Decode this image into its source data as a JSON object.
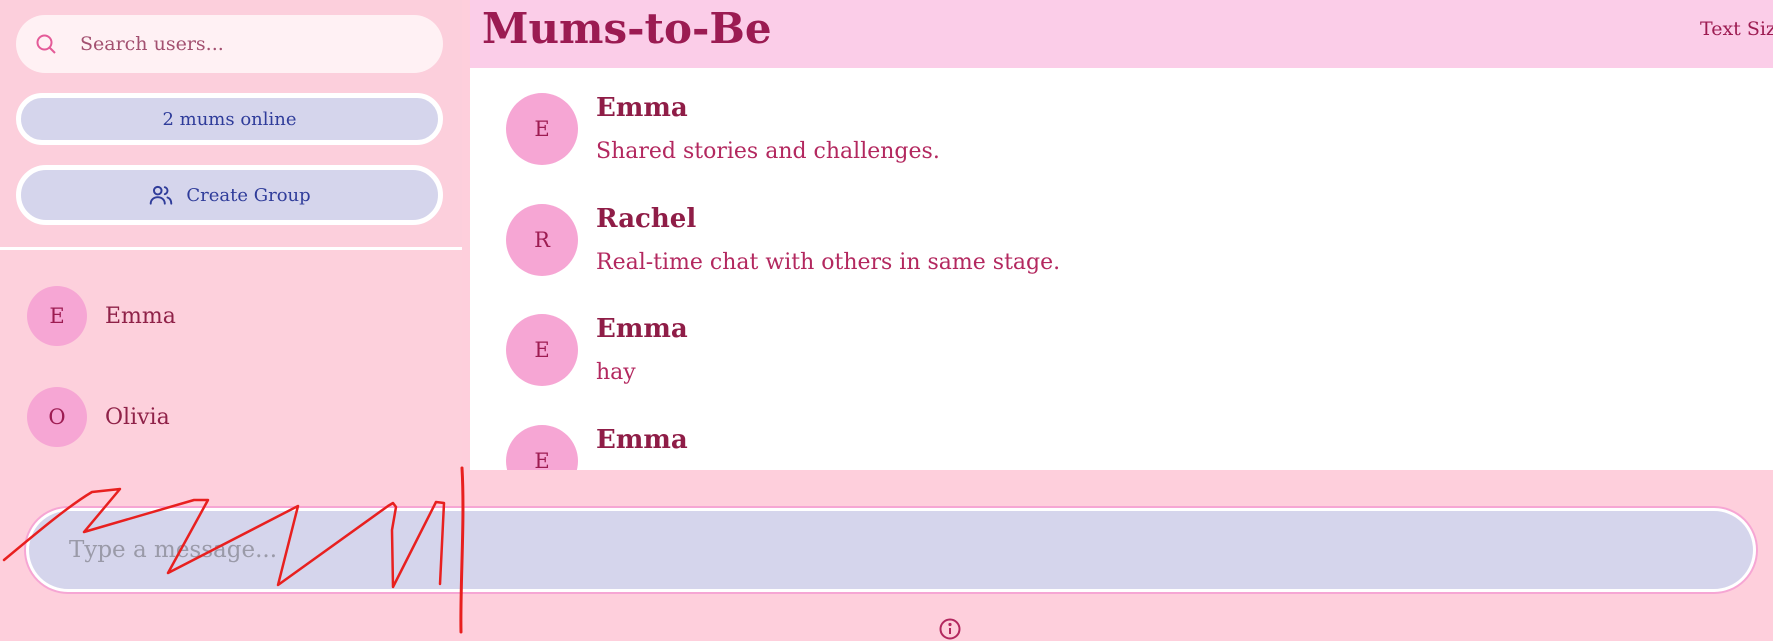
{
  "sidebar": {
    "search": {
      "placeholder": "Search users..."
    },
    "online_label": "2 mums online",
    "create_group_label": "Create Group",
    "users": [
      {
        "initial": "E",
        "name": "Emma"
      },
      {
        "initial": "O",
        "name": "Olivia"
      }
    ]
  },
  "header": {
    "title": "Mums-to-Be",
    "text_size_label": "Text Siz"
  },
  "messages": [
    {
      "initial": "E",
      "sender": "Emma",
      "text": "Shared stories and challenges."
    },
    {
      "initial": "R",
      "sender": "Rachel",
      "text": "Real-time chat with others in same stage."
    },
    {
      "initial": "E",
      "sender": "Emma",
      "text": "hay"
    },
    {
      "initial": "E",
      "sender": "Emma",
      "text": ""
    }
  ],
  "composer": {
    "placeholder": "Type a message..."
  },
  "colors": {
    "background": "#fecfdc",
    "header": "#fbcde8",
    "accent": "#9b1b52",
    "avatar": "#f6a6d4",
    "pill": "#d5d5ec",
    "pill_text": "#2f3c9a",
    "scribble": "#e8201f"
  },
  "icons": {
    "search": "search-icon",
    "create_group": "users-icon",
    "info": "info-icon"
  }
}
